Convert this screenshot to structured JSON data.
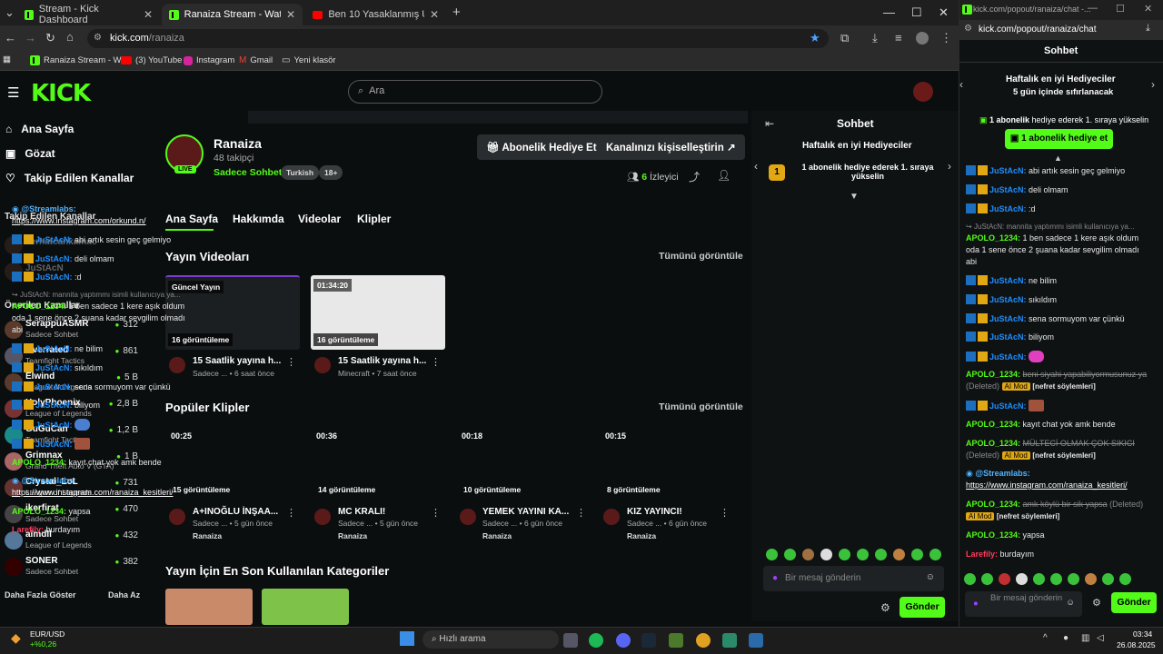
{
  "browser": {
    "tabs": [
      {
        "label": "Stream - Kick Dashboard"
      },
      {
        "label": "Ranaiza Stream - Watch Live o"
      },
      {
        "label": "Ben 10 Yasaklanmış Uzaylılar P"
      }
    ],
    "url_domain": "kick.com",
    "url_path": "/ranaiza",
    "bookmarks": [
      "Ranaiza Stream - W...",
      "(3) YouTube",
      "Instagram",
      "Gmail",
      "Yeni klasör"
    ]
  },
  "header": {
    "logo": "KICK",
    "search_placeholder": "Ara"
  },
  "sidebar": {
    "nav": [
      "Ana Sayfa",
      "Gözat",
      "Takip Edilen Kanallar"
    ],
    "followed_title": "Takip Edilen Kanallar",
    "followed": [
      "serhatcankamac",
      "JuStAcN"
    ],
    "recommended_title": "Önerilen Kanallar",
    "recommended": [
      {
        "name": "SerappuASMR",
        "cat": "Sadece Sohbet",
        "viewers": "312"
      },
      {
        "name": "Overrated",
        "cat": "Teamfight Tactics",
        "viewers": "861"
      },
      {
        "name": "Elwind",
        "cat": "League of Legends",
        "viewers": "5 B"
      },
      {
        "name": "HolyPhoenix",
        "cat": "League of Legends",
        "viewers": "2,8 B"
      },
      {
        "name": "GuGuCan",
        "cat": "Teamfight Tactics",
        "viewers": "1,2 B"
      },
      {
        "name": "Grimnax",
        "cat": "Grand Theft Auto V (GTA)",
        "viewers": "1 B"
      },
      {
        "name": "Crystal_LoL",
        "cat": "League of Legends",
        "viewers": "731"
      },
      {
        "name": "ikerfirat",
        "cat": "Sadece Sohbet",
        "viewers": "470"
      },
      {
        "name": "aimdll",
        "cat": "League of Legends",
        "viewers": "432"
      },
      {
        "name": "SONER",
        "cat": "Sadece Sohbet",
        "viewers": "382"
      }
    ],
    "show_more": "Daha Fazla Göster",
    "show_less": "Daha Az"
  },
  "channel": {
    "name": "Ranaiza",
    "followers": "48 takipçi",
    "category": "Sadece Sohbet",
    "tags": [
      "Turkish",
      "18+"
    ],
    "live": "LIVE",
    "gift_btn": "Abonelik Hediye Et",
    "customize_btn": "Kanalınızı kişiselleştirin",
    "viewers": "6",
    "viewers_label": "İzleyici"
  },
  "tabs": [
    "Ana Sayfa",
    "Hakkımda",
    "Videolar",
    "Klipler"
  ],
  "videos": {
    "title": "Yayın Videoları",
    "see_all": "Tümünü görüntüle",
    "items": [
      {
        "badge": "Güncel Yayın",
        "views": "16 görüntüleme",
        "title": "15 Saatlik yayına h...",
        "meta": "Sadece ... • 6 saat önce"
      },
      {
        "badge": "01:34:20",
        "views": "16 görüntüleme",
        "title": "15 Saatlik yayına h...",
        "meta": "Minecraft • 7 saat önce"
      }
    ]
  },
  "clips": {
    "title": "Popüler Klipler",
    "see_all": "Tümünü görüntüle",
    "items": [
      {
        "dur": "00:25",
        "views": "15 görüntüleme",
        "title": "A+INOĞLU İNŞAA...",
        "meta": "Sadece ... • 5 gün önce",
        "ch": "Ranaiza"
      },
      {
        "dur": "00:36",
        "views": "14 görüntüleme",
        "title": "MC KRALI!",
        "meta": "Sadece ... • 5 gün önce",
        "ch": "Ranaiza"
      },
      {
        "dur": "00:18",
        "views": "10 görüntüleme",
        "title": "YEMEK YAYINI KA...",
        "meta": "Sadece ... • 6 gün önce",
        "ch": "Ranaiza"
      },
      {
        "dur": "00:15",
        "views": "8 görüntüleme",
        "title": "KIZ YAYINCI!",
        "meta": "Sadece ... • 6 gün önce",
        "ch": "Ranaiza"
      }
    ]
  },
  "categories_title": "Yayın İçin En Son Kullanılan Kategoriler",
  "chat": {
    "title": "Sohbet",
    "gifters_title": "Haftalık en iyi Hediyeciler",
    "gift_line": "1 abonelik hediye ederek 1. sıraya yükselin",
    "rank": "1",
    "messages": [
      {
        "user": "@Streamlabs:",
        "text": "https://www.instagram.com/orkund.n/"
      },
      {
        "user": "JuStAcN:",
        "text": "abi artık sesin geç gelmiyo"
      },
      {
        "user": "JuStAcN:",
        "text": "deli olmam"
      },
      {
        "user": "JuStAcN:",
        "text": ":d"
      },
      {
        "reply": "JuStAcN: mannita yaptımmı isimli kullanıcıya ya..."
      },
      {
        "user": "APOLO_1234:",
        "text": "1 ben sadece 1 kere aşık oldum oda 1 sene önce 2 şuana kadar sevgilim olmadı abi"
      },
      {
        "user": "JuStAcN:",
        "text": "ne bilim"
      },
      {
        "user": "JuStAcN:",
        "text": "sıkıldım"
      },
      {
        "user": "JuStAcN:",
        "text": "sena sormuyom var çünkü"
      },
      {
        "user": "JuStAcN:",
        "text": "biliyom"
      },
      {
        "user": "JuStAcN:",
        "text": ""
      },
      {
        "user": "JuStAcN:",
        "text": ""
      },
      {
        "user": "APOLO_1234:",
        "text": "kayıt chat yok amk bende"
      },
      {
        "user": "@Streamlabs:",
        "text": "https://www.instagram.com/ranaiza_kesitleri/"
      },
      {
        "user": "APOLO_1234:",
        "text": "yapsa"
      },
      {
        "user": "Larefily:",
        "text": "burdayım"
      }
    ],
    "input_placeholder": "Bir mesaj gönderin",
    "send": "Gönder"
  },
  "popout": {
    "url": "kick.com/popout/ranaiza/chat",
    "tab_title": "kick.com/popout/ranaiza/chat -...",
    "title": "Sohbet",
    "gifters_title": "Haftalık en iyi Hediyeciler",
    "gifters_sub": "5 gün içinde sıfırlanacak",
    "gift_line_bold": "1 abonelik",
    "gift_line": "hediye ederek 1. sıraya yükselin",
    "gift_btn": "1 abonelik hediye et",
    "messages": [
      {
        "user": "JuStAcN:",
        "text": "abi artık sesin geç gelmiyo"
      },
      {
        "user": "JuStAcN:",
        "text": "deli olmam"
      },
      {
        "user": "JuStAcN:",
        "text": ":d"
      },
      {
        "reply": "JuStAcN: mannita yaptımmı isimli kullanıcıya ya..."
      },
      {
        "user": "APOLO_1234:",
        "text": "1 ben sadece 1 kere aşık oldum oda 1 sene önce 2 şuana kadar sevgilim olmadı abi"
      },
      {
        "user": "JuStAcN:",
        "text": "ne bilim"
      },
      {
        "user": "JuStAcN:",
        "text": "sıkıldım"
      },
      {
        "user": "JuStAcN:",
        "text": "sena sormuyom var çünkü"
      },
      {
        "user": "JuStAcN:",
        "text": "biliyom"
      },
      {
        "user": "JuStAcN:",
        "text": ""
      },
      {
        "user": "APOLO_1234:",
        "text": "beni siyahi yapabiliyormusunuz ya",
        "deleted": "(Deleted)",
        "mod": "AI Mod",
        "reason": "[nefret söylemleri]"
      },
      {
        "user": "JuStAcN:",
        "text": ""
      },
      {
        "user": "APOLO_1234:",
        "text": "kayıt chat yok amk bende"
      },
      {
        "user": "APOLO_1234:",
        "text": "MÜLTECİ OLMAK ÇOK SIKICI",
        "deleted": "(Deleted)",
        "mod": "AI Mod",
        "reason": "[nefret söylemleri]"
      },
      {
        "user": "@Streamlabs:",
        "text": "https://www.instagram.com/ranaiza_kesitleri/"
      },
      {
        "user": "APOLO_1234:",
        "text": "amk köylü bir sik yapsa",
        "deleted": "(Deleted)",
        "mod": "AI Mod",
        "reason": "[nefret söylemleri]"
      },
      {
        "user": "APOLO_1234:",
        "text": "yapsa"
      },
      {
        "user": "Larefily:",
        "text": "burdayım"
      }
    ],
    "input_placeholder": "Bir mesaj gönderin",
    "send": "Gönder"
  },
  "taskbar": {
    "search": "Hızlı arama",
    "time": "03:34",
    "date": "26.08.2025"
  },
  "stocks": {
    "name": "EUR/USD",
    "change": "+%0,26"
  },
  "colors": {
    "accent": "#53fc18",
    "bg": "#0b0e0f",
    "user_blue": "#1e8fff",
    "user_green": "#53fc18",
    "user_red": "#ff3b5c"
  }
}
